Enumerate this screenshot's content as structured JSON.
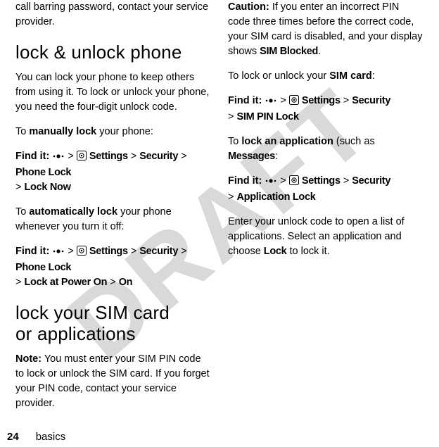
{
  "watermark": "DRAFT",
  "left": {
    "intro1": "call barring password, contact your service provider.",
    "h1": "lock & unlock phone",
    "p1": "You can lock your phone to keep others from using it. To lock or unlock your phone, you need the four-digit unlock code.",
    "p2_pre": "To ",
    "p2_bold": "manually lock",
    "p2_post": " your phone:",
    "findit": "Find it:",
    "gt": ">",
    "settings": "Settings",
    "security": "Security",
    "phonelock": "Phone Lock",
    "locknow": "Lock Now",
    "p3_pre": "To ",
    "p3_bold": "automatically lock",
    "p3_post": " your phone whenever you turn it off:",
    "lockatpower": "Lock at Power On",
    "on": "On",
    "h2a": "lock your SIM card",
    "h2b": "or applications",
    "note_label": "Note:",
    "note_text": " You must enter your SIM PIN code to lock or unlock the SIM card. If you forget your PIN code, contact your service provider."
  },
  "right": {
    "caution_label": "Caution:",
    "caution_text": " If you enter an incorrect PIN code three times before the correct code, your SIM card is disabled, and your display shows ",
    "simblocked": "SIM Blocked",
    "period": ".",
    "p1_pre": "To lock or unlock your ",
    "p1_bold": "SIM card",
    "p1_post": ":",
    "simpinlock": "SIM PIN Lock",
    "p2_pre": "To ",
    "p2_bold": "lock an application",
    "p2_post": " (such as ",
    "messages": "Messages",
    "p2_end": ":",
    "applock": "Application Lock",
    "p3": "Enter your unlock code to open a list of applications. Select an application and choose ",
    "lockword": "Lock",
    "p3end": " to lock it."
  },
  "footer": {
    "page": "24",
    "section": "basics"
  }
}
